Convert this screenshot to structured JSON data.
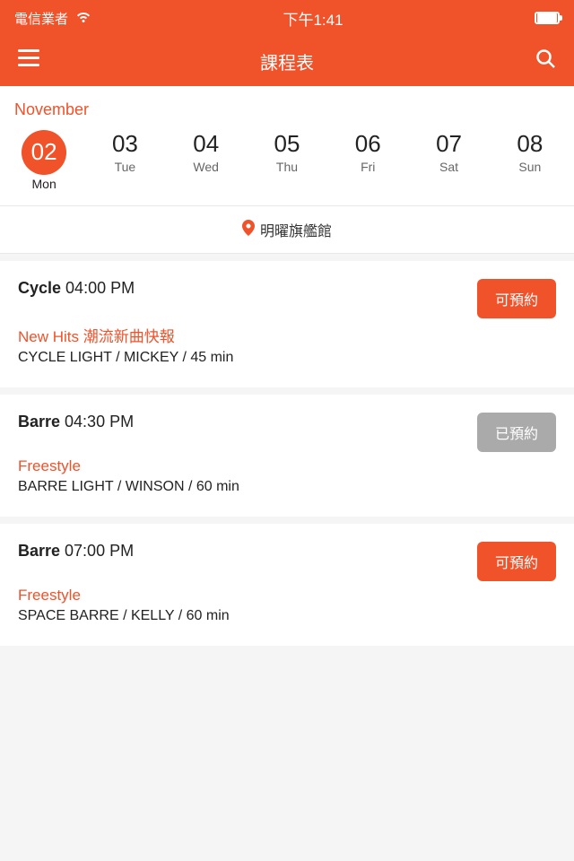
{
  "statusBar": {
    "carrier": "電信業者",
    "time": "下午1:41",
    "wifiLabel": "wifi"
  },
  "navBar": {
    "title": "課程表"
  },
  "calendar": {
    "month": "November",
    "days": [
      {
        "number": "02",
        "name": "Mon",
        "active": true
      },
      {
        "number": "03",
        "name": "Tue",
        "active": false
      },
      {
        "number": "04",
        "name": "Wed",
        "active": false
      },
      {
        "number": "05",
        "name": "Thu",
        "active": false
      },
      {
        "number": "06",
        "name": "Fri",
        "active": false
      },
      {
        "number": "07",
        "name": "Sat",
        "active": false
      },
      {
        "number": "08",
        "name": "Sun",
        "active": false
      }
    ]
  },
  "location": {
    "icon": "📍",
    "name": "明曜旗艦館"
  },
  "classes": [
    {
      "type": "Cycle",
      "time": "04:00 PM",
      "subtitle": "New Hits 潮流新曲快報",
      "detail": "CYCLE LIGHT / MICKEY / 45 min",
      "bookable": true,
      "bookLabel": "可預約",
      "bookedLabel": ""
    },
    {
      "type": "Barre",
      "time": "04:30 PM",
      "subtitle": "Freestyle",
      "detail": "BARRE LIGHT / WINSON / 60 min",
      "bookable": false,
      "bookLabel": "",
      "bookedLabel": "已預約"
    },
    {
      "type": "Barre",
      "time": "07:00 PM",
      "subtitle": "Freestyle",
      "detail": "SPACE BARRE / KELLY / 60 min",
      "bookable": true,
      "bookLabel": "可預約",
      "bookedLabel": ""
    }
  ]
}
